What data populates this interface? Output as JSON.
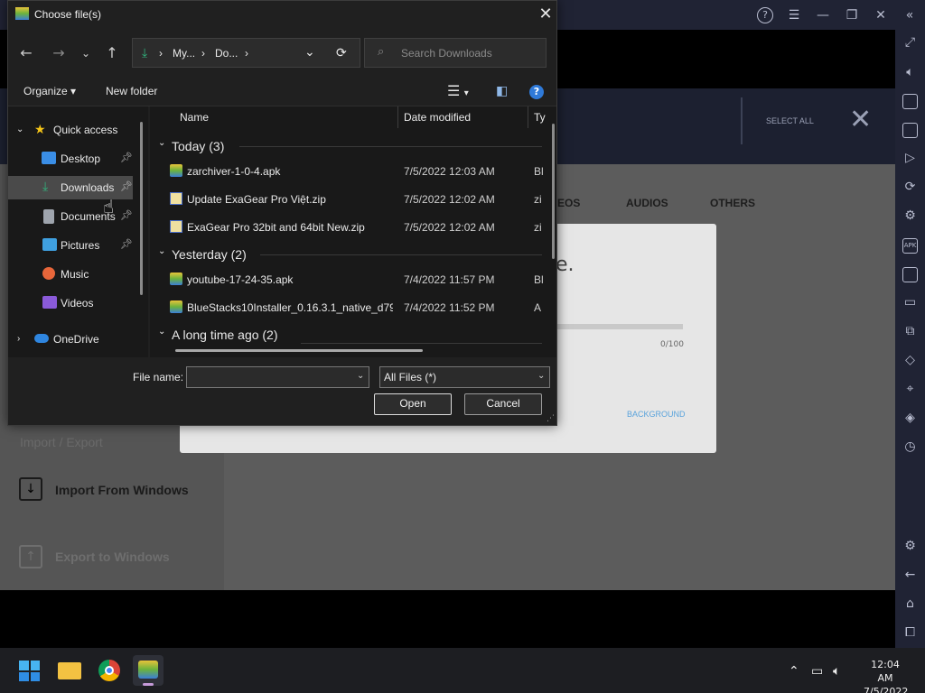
{
  "bluestacks": {
    "select_all": "SELECT ALL",
    "tabs": [
      "EOS",
      "AUDIOS",
      "OTHERS"
    ],
    "modal_text": "e.",
    "progress_count": "0/100",
    "background_link": "BACKGROUND",
    "import_export_title": "Import / Export",
    "import_label": "Import From Windows",
    "export_label": "Export to Windows"
  },
  "dialog": {
    "title": "Choose file(s)",
    "address": {
      "seg1": "My...",
      "seg2": "Do...",
      "sep": "›"
    },
    "search_placeholder": "Search Downloads",
    "organize": "Organize",
    "new_folder": "New folder",
    "nav": {
      "quick_access": "Quick access",
      "items": [
        "Desktop",
        "Downloads",
        "Documents",
        "Pictures",
        "Music",
        "Videos"
      ],
      "onedrive": "OneDrive"
    },
    "columns": {
      "name": "Name",
      "date": "Date modified",
      "type": "Ty"
    },
    "groups": [
      {
        "label": "Today (3)",
        "files": [
          {
            "name": "zarchiver-1-0-4.apk",
            "date": "7/5/2022 12:03 AM",
            "type": "Bl"
          },
          {
            "name": "Update ExaGear Pro Việt.zip",
            "date": "7/5/2022 12:02 AM",
            "type": "zi"
          },
          {
            "name": "ExaGear Pro 32bit and 64bit New.zip",
            "date": "7/5/2022 12:02 AM",
            "type": "zi"
          }
        ]
      },
      {
        "label": "Yesterday (2)",
        "files": [
          {
            "name": "youtube-17-24-35.apk",
            "date": "7/4/2022 11:57 PM",
            "type": "Bl"
          },
          {
            "name": "BlueStacks10Installer_0.16.3.1_native_d79...",
            "date": "7/4/2022 11:52 PM",
            "type": "A"
          }
        ]
      },
      {
        "label": "A long time ago (2)",
        "files": []
      }
    ],
    "file_name_label": "File name:",
    "file_name_value": "",
    "file_type": "All Files (*)",
    "open": "Open",
    "cancel": "Cancel"
  },
  "taskbar": {
    "time": "12:04 AM",
    "date": "7/5/2022"
  },
  "colors": {
    "accent": "#5aa3dc",
    "dialog_bg": "#202020",
    "taskbar_bg": "#1d1e22"
  }
}
